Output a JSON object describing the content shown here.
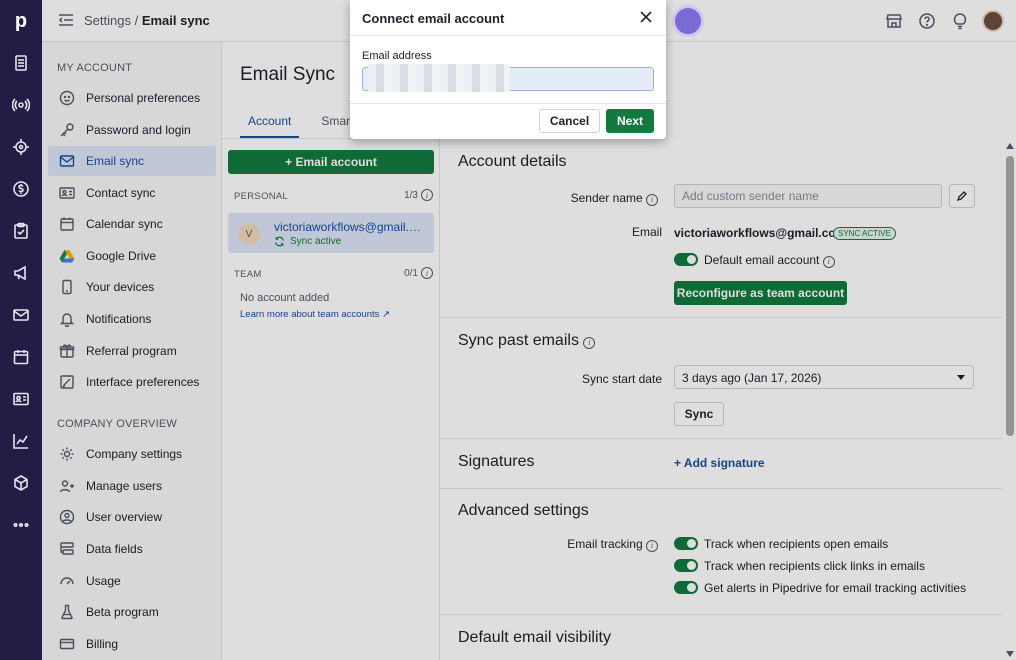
{
  "rail": {
    "logo": "p",
    "icons": [
      "deals-icon",
      "leads-icon",
      "insights-icon",
      "money-icon",
      "tasks-icon",
      "campaigns-icon",
      "mail-icon",
      "calendar-icon",
      "contacts-icon",
      "reports-icon",
      "products-icon",
      "more-icon"
    ]
  },
  "header": {
    "breadcrumb_parent": "Settings",
    "breadcrumb_sep": " / ",
    "breadcrumb_current": "Email sync"
  },
  "sidebar": {
    "section1": "MY ACCOUNT",
    "items1": [
      {
        "label": "Personal preferences",
        "icon": "face-icon"
      },
      {
        "label": "Password and login",
        "icon": "key-icon"
      },
      {
        "label": "Email sync",
        "icon": "mail-icon",
        "active": true
      },
      {
        "label": "Contact sync",
        "icon": "contact-card-icon"
      },
      {
        "label": "Calendar sync",
        "icon": "calendar-icon"
      },
      {
        "label": "Google Drive",
        "icon": "google-drive-icon"
      },
      {
        "label": "Your devices",
        "icon": "phone-icon"
      },
      {
        "label": "Notifications",
        "icon": "bell-icon"
      },
      {
        "label": "Referral program",
        "icon": "gift-icon"
      },
      {
        "label": "Interface preferences",
        "icon": "brush-icon"
      }
    ],
    "section2": "COMPANY OVERVIEW",
    "items2": [
      {
        "label": "Company settings",
        "icon": "gear-icon"
      },
      {
        "label": "Manage users",
        "icon": "users-icon"
      },
      {
        "label": "User overview",
        "icon": "user-circle-icon"
      },
      {
        "label": "Data fields",
        "icon": "fields-icon"
      },
      {
        "label": "Usage",
        "icon": "gauge-icon"
      },
      {
        "label": "Beta program",
        "icon": "flask-icon"
      },
      {
        "label": "Billing",
        "icon": "card-icon"
      }
    ]
  },
  "content": {
    "title": "Email Sync",
    "tabs": [
      "Account",
      "Smart Bcc"
    ],
    "add_button": "+ Email account",
    "personal_label": "PERSONAL",
    "personal_count": "1/3",
    "account_initial": "V",
    "account_email": "victoriaworkflows@gmail.com",
    "account_status": "Sync active",
    "team_label": "TEAM",
    "team_count": "0/1",
    "no_account": "No account added",
    "learn_more": "Learn more about team accounts ↗"
  },
  "details": {
    "account_title": "Account details",
    "sender_label": "Sender name",
    "sender_placeholder": "Add custom sender name",
    "email_label": "Email",
    "email_value": "victoriaworkflows@gmail.com",
    "sync_badge": "SYNC ACTIVE",
    "default_label": "Default email account",
    "reconfigure_button": "Reconfigure as team account",
    "sync_past_title": "Sync past emails",
    "sync_start_label": "Sync start date",
    "sync_start_value": "3 days ago (Jan 17, 2026)",
    "sync_button": "Sync",
    "signatures_title": "Signatures",
    "add_signature": "+ Add signature",
    "advanced_title": "Advanced settings",
    "tracking_label": "Email tracking",
    "tracking_opts": [
      "Track when recipients open emails",
      "Track when recipients click links in emails",
      "Get alerts in Pipedrive for email tracking activities"
    ],
    "visibility_title": "Default email visibility"
  },
  "modal": {
    "title": "Connect email account",
    "field_label": "Email address",
    "cancel": "Cancel",
    "next": "Next"
  },
  "colors": {
    "rail": "#231d46",
    "accent_green": "#127a3e",
    "link_blue": "#1b4ea3"
  }
}
